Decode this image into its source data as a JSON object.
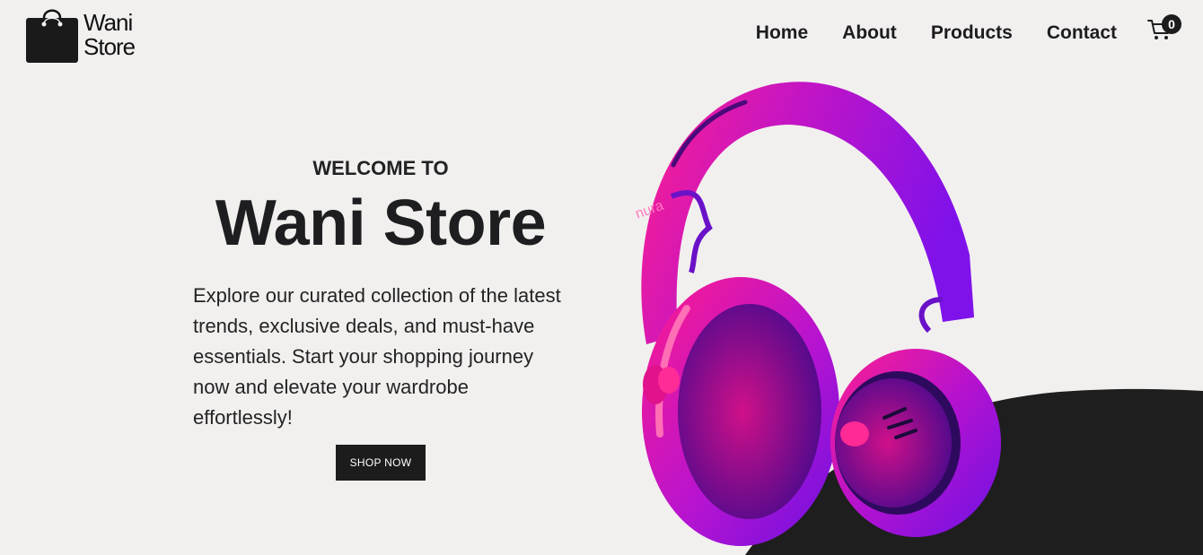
{
  "brand": {
    "line1": "Wani",
    "line2": "Store"
  },
  "nav": {
    "items": [
      {
        "label": "Home"
      },
      {
        "label": "About"
      },
      {
        "label": "Products"
      },
      {
        "label": "Contact"
      }
    ]
  },
  "cart": {
    "count": "0",
    "icon": "cart-icon"
  },
  "hero": {
    "kicker": "WELCOME TO",
    "title": "Wani Store",
    "description": "Explore our curated collection of the latest trends, exclusive deals, and must-have essentials. Start your shopping journey now and elevate your wardrobe effortlessly!",
    "cta": "SHOP NOW"
  },
  "product_image": {
    "brand_mark": "nura",
    "icon": "headphones-image"
  },
  "colors": {
    "background": "#f2f0ef",
    "dark": "#1c1c1c",
    "magenta": "#ff1a8c",
    "purple": "#7a12e6"
  }
}
